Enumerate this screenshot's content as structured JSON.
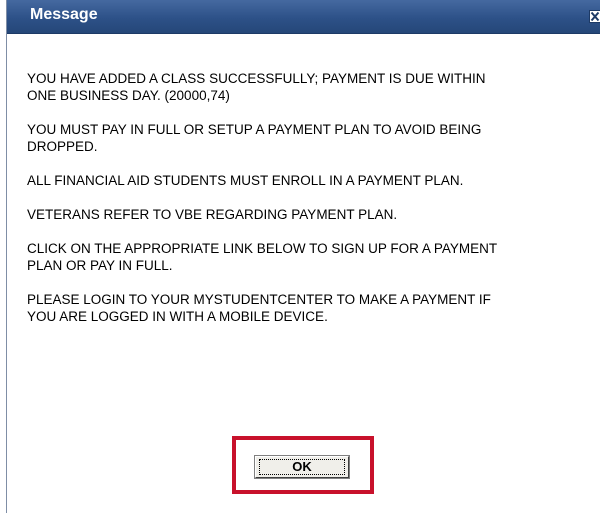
{
  "dialog": {
    "title": "Message",
    "close_glyph": "✕",
    "messages": [
      "YOU HAVE ADDED A CLASS SUCCESSFULLY; PAYMENT IS DUE WITHIN\nONE BUSINESS DAY. (20000,74)",
      "YOU MUST PAY IN FULL OR SETUP A PAYMENT PLAN TO AVOID BEING\nDROPPED.",
      "ALL FINANCIAL AID STUDENTS MUST ENROLL IN A PAYMENT PLAN.",
      "VETERANS REFER TO VBE REGARDING PAYMENT PLAN.",
      "CLICK ON THE APPROPRIATE LINK BELOW TO SIGN UP FOR A PAYMENT\nPLAN OR PAY IN FULL.",
      "PLEASE LOGIN TO YOUR MYSTUDENTCENTER TO MAKE A PAYMENT IF\nYOU ARE LOGGED IN WITH A MOBILE DEVICE."
    ],
    "ok_label": "OK"
  },
  "colors": {
    "titlebar": "#2d5188",
    "highlight": "#c8112b"
  },
  "icons": {
    "close": "close-icon"
  }
}
